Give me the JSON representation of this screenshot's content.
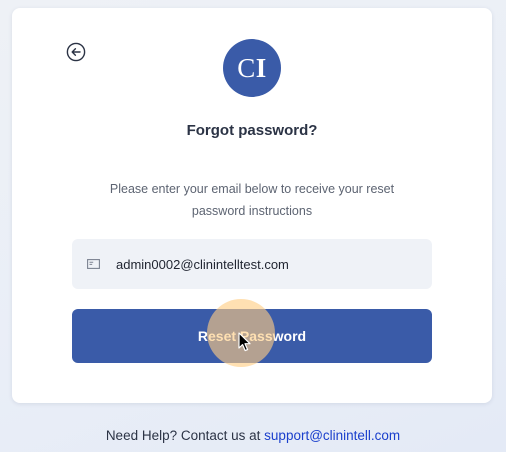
{
  "logo": {
    "letter_c": "C",
    "letter_i": "I"
  },
  "header": {
    "title": "Forgot password?"
  },
  "instructions": {
    "line1": "Please enter your email below to receive your reset",
    "line2": "password instructions"
  },
  "email": {
    "value": "admin0002@clinintelltest.com",
    "icon": "envelope-icon"
  },
  "actions": {
    "reset_label": "Reset Password",
    "back_icon": "back-arrow-icon"
  },
  "footer": {
    "help_text": "Need Help? Contact us at",
    "support_email": "support@clinintell.com"
  },
  "colors": {
    "brand": "#3a5ba8",
    "link": "#1a3fcc",
    "field_bg": "#eff2f7"
  }
}
